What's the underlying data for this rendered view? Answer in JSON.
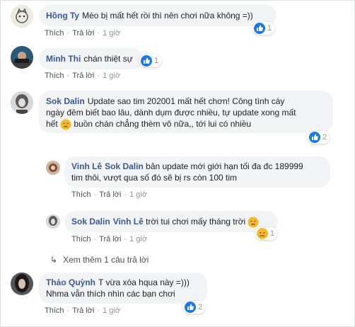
{
  "actions": {
    "like": "Thích",
    "reply": "Trả lời",
    "time": "1 giờ"
  },
  "comments": [
    {
      "author": "Hồng Ty",
      "text": "Mèo bị mất hết rồi thì nên chơi nữa không =))",
      "likes": "1"
    },
    {
      "author": "Minh Thi",
      "text": "chán thiệt sự",
      "likes": "1"
    },
    {
      "author": "Sok Dalin",
      "line1": "Update sao tim 202001 mất hết chơn! Công tình cày",
      "line2": "ngày đêm biết bao lâu, dành dụm được nhiều, tự update xong mất",
      "line3a": "hết",
      "line3b": "buồn chán chẳng thèm vô nữa,, tới lui có nhiều",
      "likes": "2"
    },
    {
      "author": "Vinh Lê",
      "mention": "Sok Dalin",
      "line1": "bản update mới giới hạn tối đa đc 189999",
      "line2": "tim thôi, vượt qua số đó sẽ bị rs còn 100 tim"
    },
    {
      "author": "Sok Dalin",
      "mention": "Vinh Lê",
      "text": "trời tui chơi mấy tháng trời",
      "likes": "1"
    },
    {
      "author": "Thảo Quỳnh",
      "line1": "T vừa xóa hqua này =)))",
      "line2": "Nhma vẫn thích nhìn các bạn chơi",
      "likes": "2"
    }
  ],
  "more_replies": "Xem thêm 1 câu trả lời",
  "colors": {
    "link": "#385898",
    "bubble": "#f2f3f5",
    "like_blue": "#1877f2",
    "meta": "#90949c"
  }
}
